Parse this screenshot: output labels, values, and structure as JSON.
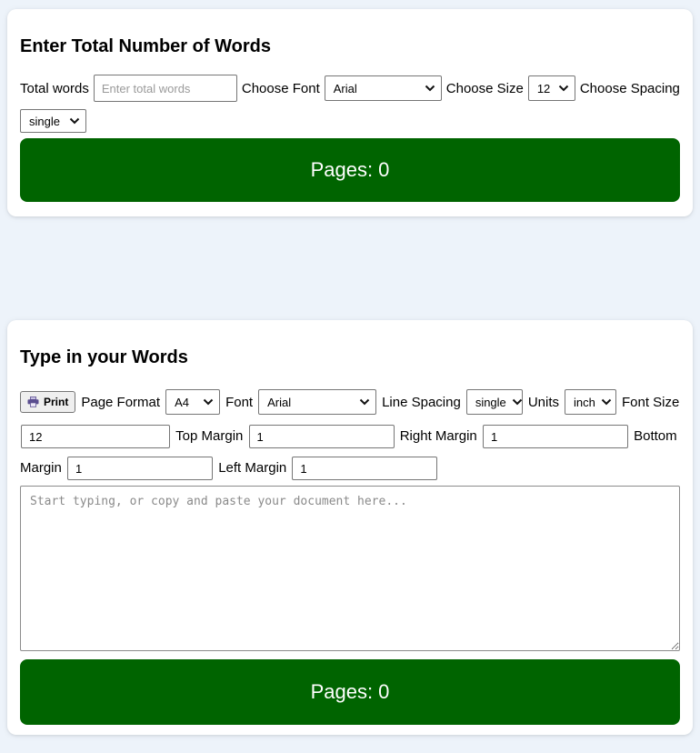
{
  "page": {
    "background_color": "#edf3fa",
    "accent_green": "#006400"
  },
  "icons": {
    "chevron_down": "chevron-down-icon",
    "printer": "printer-icon"
  },
  "word_count_card": {
    "title": "Enter Total Number of Words",
    "total_words_label": "Total words",
    "total_words_placeholder": "Enter total words",
    "choose_font_label": "Choose Font",
    "font_value": "Arial",
    "choose_size_label": "Choose Size",
    "size_value": "12",
    "choose_spacing_label": "Choose Spacing",
    "spacing_value": "single",
    "pages_result": "Pages: 0"
  },
  "type_words_card": {
    "title": "Type in your Words",
    "print_label": "Print",
    "page_format_label": "Page Format",
    "page_format_value": "A4",
    "font_label": "Font",
    "font_value": "Arial",
    "line_spacing_label": "Line Spacing",
    "line_spacing_value": "single",
    "units_label": "Units",
    "units_value": "inch",
    "font_size_label": "Font Size",
    "font_size_value": "12",
    "top_margin_label": "Top Margin",
    "top_margin_value": "1",
    "right_margin_label": "Right Margin",
    "right_margin_value": "1",
    "bottom_margin_label": "Bottom Margin",
    "bottom_margin_value": "1",
    "left_margin_label": "Left Margin",
    "left_margin_value": "1",
    "editor_placeholder": "Start typing, or copy and paste your document here...",
    "pages_result": "Pages: 0"
  }
}
